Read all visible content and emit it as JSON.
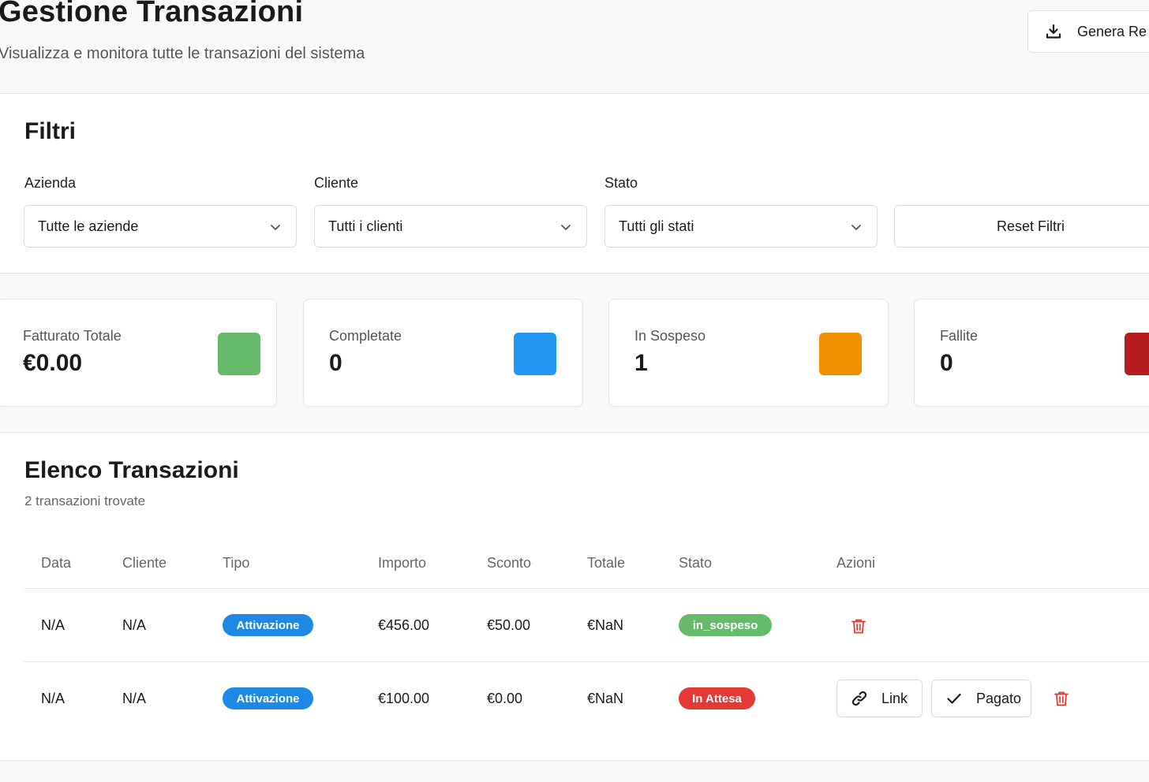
{
  "header": {
    "title": "Gestione Transazioni",
    "subtitle": "Visualizza e monitora tutte le transazioni del sistema",
    "report_button_label": "Genera Re"
  },
  "filters": {
    "title": "Filtri",
    "azienda": {
      "label": "Azienda",
      "value": "Tutte le aziende"
    },
    "cliente": {
      "label": "Cliente",
      "value": "Tutti i clienti"
    },
    "stato": {
      "label": "Stato",
      "value": "Tutti gli stati"
    },
    "reset_label": "Reset Filtri"
  },
  "stats": [
    {
      "label": "Fatturato Totale",
      "value": "€0.00",
      "color": "#66bb6a"
    },
    {
      "label": "Completate",
      "value": "0",
      "color": "#2196f3"
    },
    {
      "label": "In Sospeso",
      "value": "1",
      "color": "#f29100"
    },
    {
      "label": "Fallite",
      "value": "0",
      "color": "#b71c1c"
    }
  ],
  "transactions": {
    "title": "Elenco Transazioni",
    "count_text": "2 transazioni trovate",
    "columns": [
      "Data",
      "Cliente",
      "Tipo",
      "Importo",
      "Sconto",
      "Totale",
      "Stato",
      "Azioni"
    ],
    "rows": [
      {
        "data": "N/A",
        "cliente": "N/A",
        "tipo": "Attivazione",
        "importo": "€456.00",
        "sconto": "€50.00",
        "totale": "€NaN",
        "stato": "in_sospeso",
        "stato_color": "#66bb6a"
      },
      {
        "data": "N/A",
        "cliente": "N/A",
        "tipo": "Attivazione",
        "importo": "€100.00",
        "sconto": "€0.00",
        "totale": "€NaN",
        "stato": "In Attesa",
        "stato_color": "#e53935",
        "link_label": "Link",
        "pagato_label": "Pagato"
      }
    ]
  },
  "colors": {
    "tipo_badge": "#1e88e5",
    "delete_icon": "#e53935"
  }
}
